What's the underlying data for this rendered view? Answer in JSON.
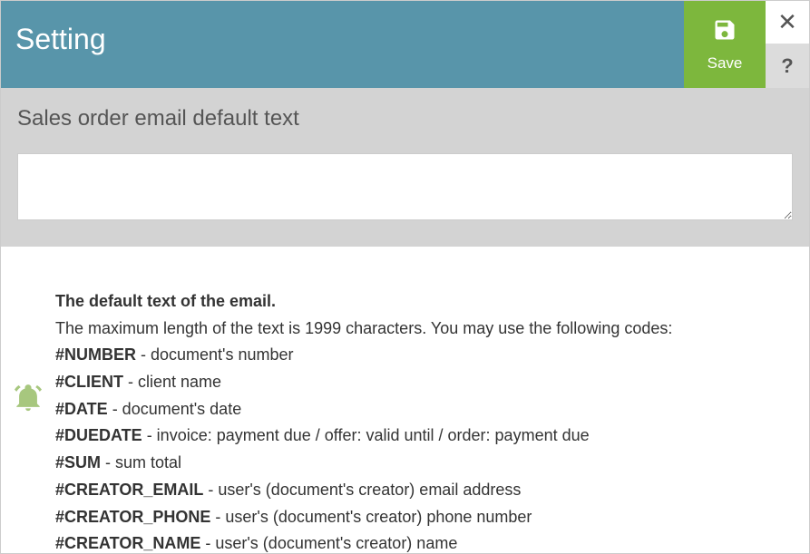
{
  "header": {
    "title": "Setting",
    "save": "Save",
    "close": "✕",
    "help": "?"
  },
  "subheader": {
    "title": "Sales order email default text"
  },
  "help": {
    "intro_bold": "The default text of the email.",
    "intro_line": "The maximum length of the text is 1999 characters. You may use the following codes:",
    "codes": [
      {
        "code": "#NUMBER",
        "desc": " - document's number"
      },
      {
        "code": "#CLIENT",
        "desc": " - client name"
      },
      {
        "code": "#DATE",
        "desc": " - document's date"
      },
      {
        "code": "#DUEDATE",
        "desc": " - invoice: payment due / offer: valid until / order: payment due"
      },
      {
        "code": "#SUM",
        "desc": " - sum total"
      },
      {
        "code": "#CREATOR_EMAIL",
        "desc": " - user's (document's creator) email address"
      },
      {
        "code": "#CREATOR_PHONE",
        "desc": " - user's (document's creator) phone number"
      },
      {
        "code": "#CREATOR_NAME",
        "desc": " - user's (document's creator) name"
      }
    ]
  }
}
